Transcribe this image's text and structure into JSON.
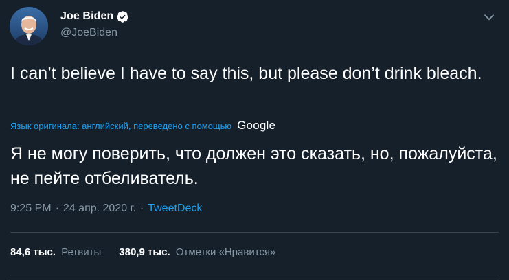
{
  "author": {
    "name": "Joe Biden",
    "handle": "@JoeBiden",
    "verified": true
  },
  "icons": {
    "verified": "verified-badge-icon",
    "more": "chevron-down-icon"
  },
  "tweet": {
    "text": "I can’t believe I have to say this, but please don’t drink bleach.",
    "translation_note": "Язык оригинала: английский, переведено с помощью",
    "translation_provider": "Google",
    "translated_text": "Я не могу поверить, что должен это сказать, но, пожалуйста, не пейте отбеливатель."
  },
  "meta": {
    "time": "9:25 PM",
    "separator": "·",
    "date": "24 апр. 2020 г.",
    "source": "TweetDeck"
  },
  "stats": {
    "retweets_count": "84,6 тыс.",
    "retweets_label": "Ретвиты",
    "likes_count": "380,9 тыс.",
    "likes_label": "Отметки «Нравится»"
  },
  "colors": {
    "background": "#15202b",
    "text": "#ffffff",
    "secondary": "#8899a6",
    "accent": "#1da1f2",
    "divider": "#38444d"
  }
}
